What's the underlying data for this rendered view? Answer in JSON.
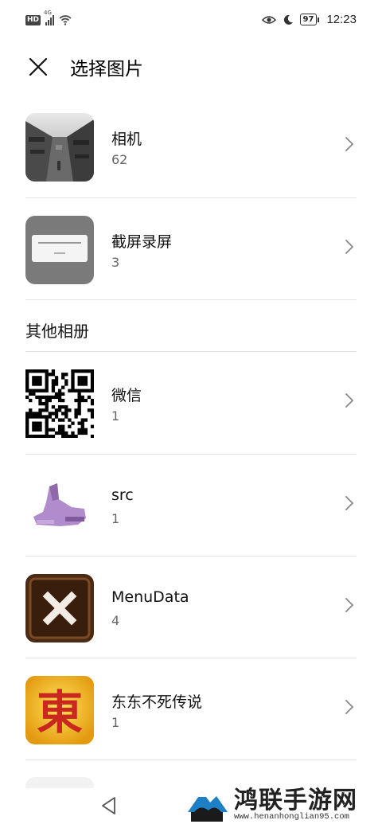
{
  "status_bar": {
    "hd": "HD",
    "network": "4G",
    "battery": "97",
    "time": "12:23",
    "icons": [
      "hd-icon",
      "signal-icon",
      "wifi-icon",
      "eye-icon",
      "moon-icon",
      "battery-icon"
    ]
  },
  "header": {
    "title": "选择图片",
    "close_icon": "close-icon"
  },
  "albums": [
    {
      "name": "相机",
      "count": "62"
    },
    {
      "name": "截屏录屏",
      "count": "3"
    }
  ],
  "other_section": {
    "title": "其他相册",
    "albums": [
      {
        "name": "微信",
        "count": "1"
      },
      {
        "name": "src",
        "count": "1"
      },
      {
        "name": "MenuData",
        "count": "4"
      },
      {
        "name": "东东不死传说",
        "count": "1"
      }
    ]
  },
  "thumbnails": {
    "camera_char": "",
    "game_char": "東"
  },
  "watermark": {
    "title": "鸿联手游网",
    "url": "www.henanhonglian95.com"
  },
  "colors": {
    "divider": "#e4e4e4",
    "count_text": "#666666",
    "accent_red": "#c8281e"
  }
}
